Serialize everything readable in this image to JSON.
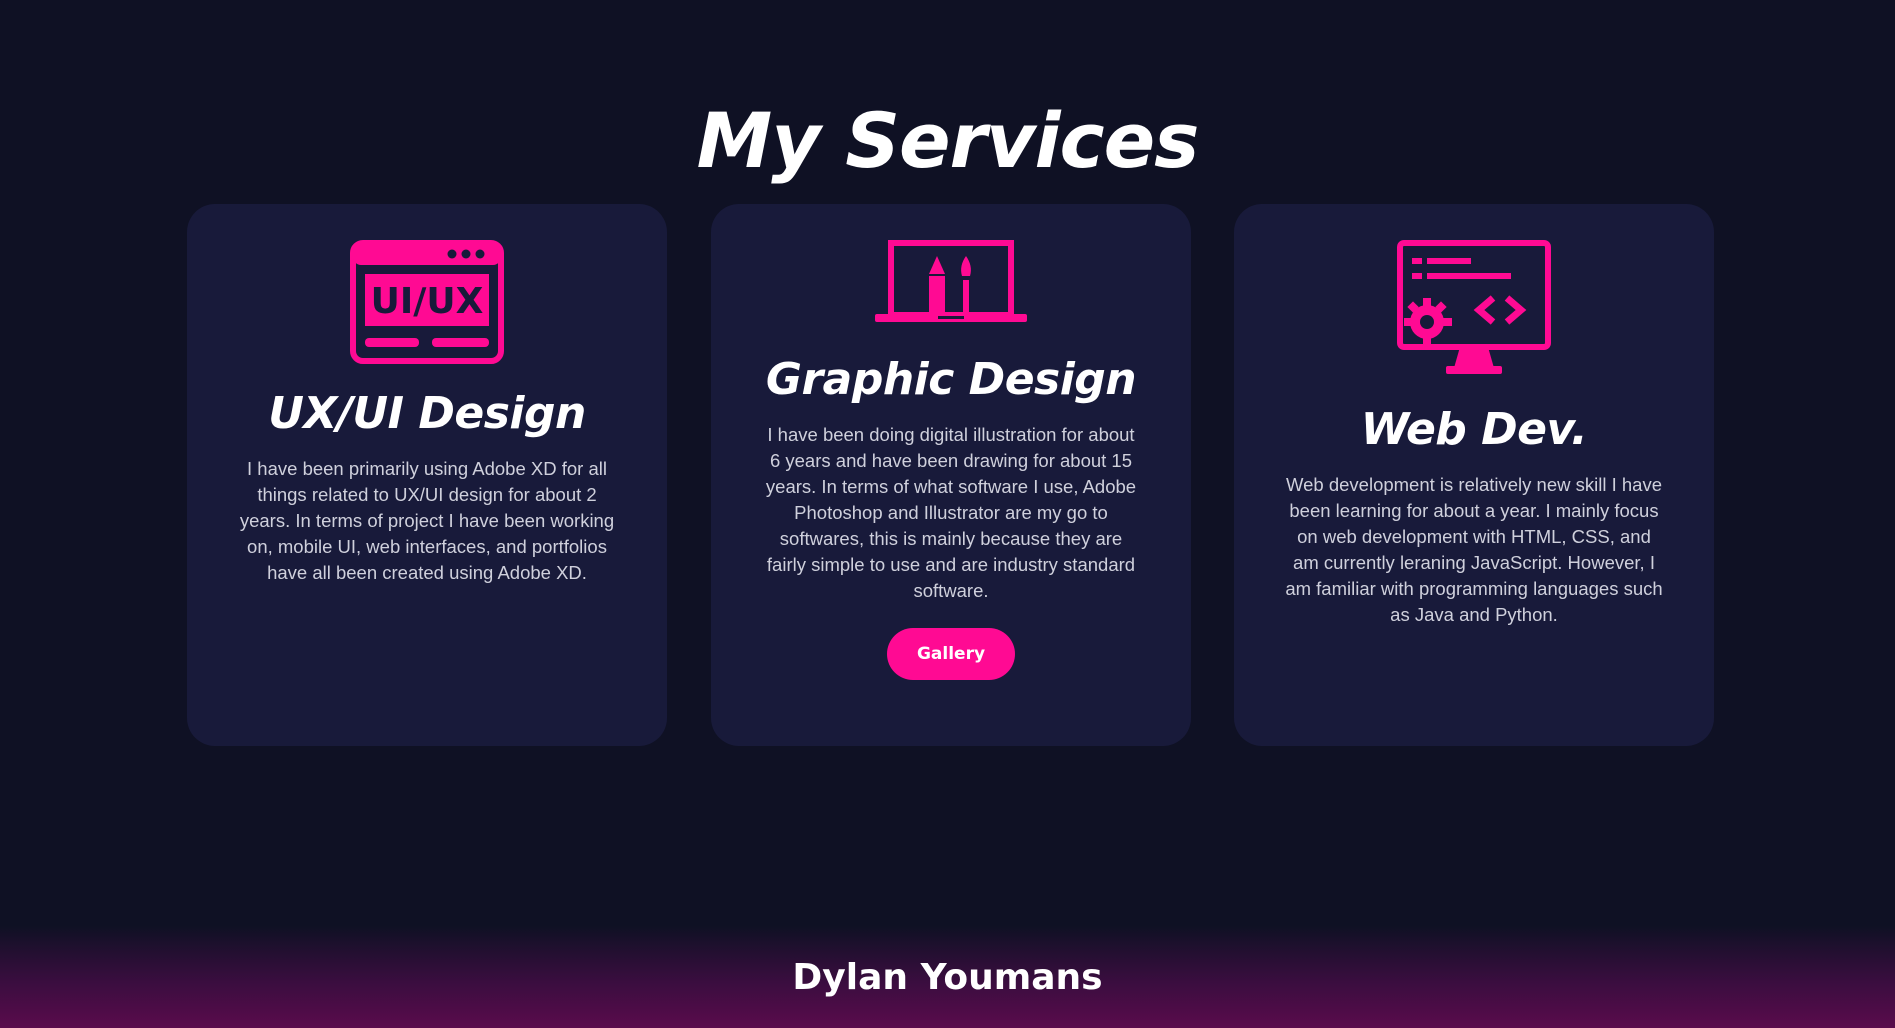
{
  "page": {
    "title": "My Services",
    "accent_color": "#ff0a93",
    "background_color": "#0f1124",
    "card_color": "#181a3a"
  },
  "services": [
    {
      "icon": "ui-ux-browser-icon",
      "icon_text": "UI/UX",
      "title": "UX/UI Design",
      "description": "I have been primarily using Adobe XD for all things related to UX/UI design for about 2 years. In terms of project I have been working on, mobile UI, web interfaces, and portfolios have all been created using Adobe XD."
    },
    {
      "icon": "laptop-pen-brush-icon",
      "title": "Graphic Design",
      "description": "I have been doing digital illustration for about 6 years and have been drawing for about 15 years. In terms of what software I use, Adobe Photoshop and Illustrator are my go to softwares, this is mainly because they are fairly simple to use and are industry standard software.",
      "button_label": "Gallery"
    },
    {
      "icon": "monitor-code-gear-icon",
      "title": "Web Dev.",
      "description": "Web development is relatively new skill I have been learning for about a year. I mainly focus on web development with HTML, CSS, and am currently leraning JavaScript. However, I am familiar with programming languages such as Java and Python."
    }
  ],
  "footer": {
    "name": "Dylan Youmans"
  }
}
